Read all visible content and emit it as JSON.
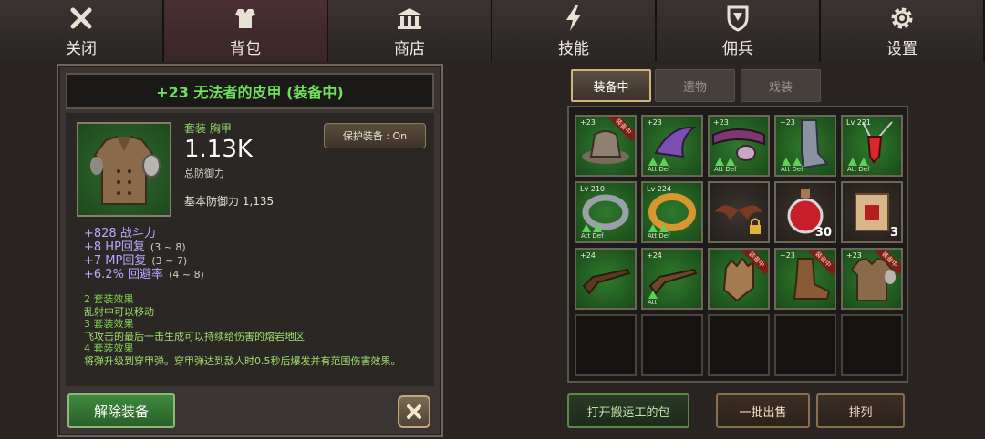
{
  "nav": {
    "tabs": [
      {
        "label": "关闭",
        "icon": "close-icon"
      },
      {
        "label": "背包",
        "icon": "armor-icon"
      },
      {
        "label": "商店",
        "icon": "shop-icon"
      },
      {
        "label": "技能",
        "icon": "lightning-icon"
      },
      {
        "label": "佣兵",
        "icon": "shield-icon"
      },
      {
        "label": "设置",
        "icon": "gear-icon"
      }
    ],
    "active": "背包"
  },
  "item": {
    "title": "+23 无法者的皮甲 (装备中)",
    "slot": "套装 胸甲",
    "total_defense": "1.13K",
    "total_defense_label": "总防御力",
    "base_defense": "基本防御力 1,135",
    "protect_label": "保护装备 : On",
    "stats": [
      {
        "text": "+828 战斗力",
        "range": ""
      },
      {
        "text": "+8 HP回复",
        "range": "(3 ~ 8)"
      },
      {
        "text": "+7 MP回复",
        "range": "(3 ~ 7)"
      },
      {
        "text": "+6.2% 回避率",
        "range": "(4 ~ 8)"
      }
    ],
    "sets": [
      {
        "header": "2 套装效果",
        "desc": "乱射中可以移动"
      },
      {
        "header": "3 套装效果",
        "desc": "飞攻击的最后一击生成可以持续给伤害的熔岩地区"
      },
      {
        "header": "4 套装效果",
        "desc": "将弹升级到穿甲弹。穿甲弹达到敌人时0.5秒后爆发并有范围伤害效果。"
      }
    ],
    "unequip_label": "解除装备"
  },
  "inventory": {
    "tabs": [
      "装备中",
      "遗物",
      "戏装"
    ],
    "slots": [
      {
        "badge": "+23",
        "equipped": true,
        "icon": "hat-icon",
        "att_def": false,
        "count": ""
      },
      {
        "badge": "+23",
        "equipped": false,
        "icon": "bracer-icon",
        "att_def": true,
        "count": ""
      },
      {
        "badge": "+23",
        "equipped": false,
        "icon": "belt-icon",
        "att_def": true,
        "count": ""
      },
      {
        "badge": "+23",
        "equipped": false,
        "icon": "greaves-icon",
        "att_def": true,
        "count": ""
      },
      {
        "badge": "Lv 221",
        "equipped": false,
        "icon": "amulet-icon",
        "att_def": true,
        "count": ""
      },
      {
        "badge": "Lv 210",
        "equipped": false,
        "icon": "ring-icon",
        "att_def": true,
        "count": ""
      },
      {
        "badge": "Lv 224",
        "equipped": false,
        "icon": "gold-ring-icon",
        "att_def": true,
        "count": ""
      },
      {
        "badge": "",
        "equipped": false,
        "icon": "wings-locked-icon",
        "att_def": false,
        "count": ""
      },
      {
        "badge": "",
        "equipped": false,
        "icon": "potion-icon",
        "att_def": false,
        "count": "30"
      },
      {
        "badge": "",
        "equipped": false,
        "icon": "scroll-icon",
        "att_def": false,
        "count": "3"
      },
      {
        "badge": "+24",
        "equipped": false,
        "icon": "rifle-icon",
        "att_def": false,
        "count": ""
      },
      {
        "badge": "+24",
        "equipped": false,
        "icon": "rifle-icon",
        "att_def": false,
        "count": "",
        "att_only": true
      },
      {
        "badge": "",
        "equipped": true,
        "icon": "glove-icon",
        "att_def": false,
        "count": ""
      },
      {
        "badge": "+23",
        "equipped": true,
        "icon": "boots-icon",
        "att_def": false,
        "count": ""
      },
      {
        "badge": "+23",
        "equipped": true,
        "icon": "armor-icon",
        "att_def": false,
        "count": ""
      }
    ],
    "equipped_tag": "装备中",
    "att_label": "Att",
    "def_label": "Def",
    "buttons": [
      "打开搬运工的包",
      "一批出售",
      "排列"
    ]
  }
}
